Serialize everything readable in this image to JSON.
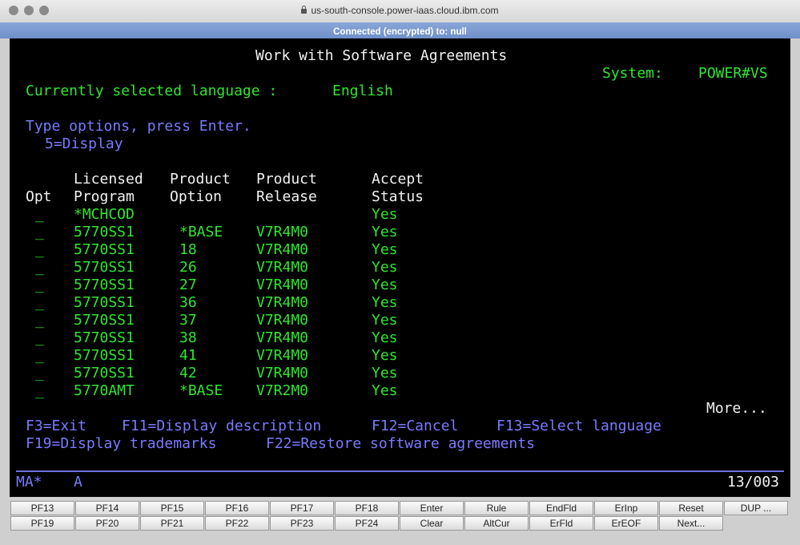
{
  "window": {
    "url": "us-south-console.power-iaas.cloud.ibm.com",
    "connection_status": "Connected (encrypted) to: null"
  },
  "screen": {
    "title": "Work with Software Agreements",
    "system_label": "System:",
    "system_name": "POWER#VS",
    "language_label": "Currently selected language :",
    "language_value": "English",
    "instruction": "Type options, press Enter.",
    "option_5": "5=Display",
    "headers": {
      "col1_line2": "Opt",
      "col2_line1": "Licensed",
      "col2_line2": "Program",
      "col3_line1": "Product",
      "col3_line2": "Option",
      "col4_line1": "Product",
      "col4_line2": "Release",
      "col5_line1": "Accept",
      "col5_line2": "Status"
    },
    "rows": [
      {
        "opt": "_",
        "program": "*MCHCOD",
        "option": "",
        "release": "",
        "status": "Yes"
      },
      {
        "opt": "_",
        "program": "5770SS1",
        "option": "*BASE",
        "release": "V7R4M0",
        "status": "Yes"
      },
      {
        "opt": "_",
        "program": "5770SS1",
        "option": "18",
        "release": "V7R4M0",
        "status": "Yes"
      },
      {
        "opt": "_",
        "program": "5770SS1",
        "option": "26",
        "release": "V7R4M0",
        "status": "Yes"
      },
      {
        "opt": "_",
        "program": "5770SS1",
        "option": "27",
        "release": "V7R4M0",
        "status": "Yes"
      },
      {
        "opt": "_",
        "program": "5770SS1",
        "option": "36",
        "release": "V7R4M0",
        "status": "Yes"
      },
      {
        "opt": "_",
        "program": "5770SS1",
        "option": "37",
        "release": "V7R4M0",
        "status": "Yes"
      },
      {
        "opt": "_",
        "program": "5770SS1",
        "option": "38",
        "release": "V7R4M0",
        "status": "Yes"
      },
      {
        "opt": "_",
        "program": "5770SS1",
        "option": "41",
        "release": "V7R4M0",
        "status": "Yes"
      },
      {
        "opt": "_",
        "program": "5770SS1",
        "option": "42",
        "release": "V7R4M0",
        "status": "Yes"
      },
      {
        "opt": "_",
        "program": "5770AMT",
        "option": "*BASE",
        "release": "V7R2M0",
        "status": "Yes"
      }
    ],
    "more": "More...",
    "fkeys_line1": [
      "F3=Exit",
      "F11=Display description",
      "F12=Cancel",
      "F13=Select language"
    ],
    "fkeys_line2": [
      "F19=Display trademarks",
      "F22=Restore software agreements"
    ],
    "status_left": "MA*",
    "status_mid": "A",
    "cursor_pos": "13/003"
  },
  "keypad": {
    "row1": [
      "PF13",
      "PF14",
      "PF15",
      "PF16",
      "PF17",
      "PF18",
      "Enter",
      "Rule",
      "EndFld",
      "ErInp",
      "Reset",
      "DUP ..."
    ],
    "row2": [
      "PF19",
      "PF20",
      "PF21",
      "PF22",
      "PF23",
      "PF24",
      "Clear",
      "AltCur",
      "ErFld",
      "ErEOF",
      "Next...",
      ""
    ]
  }
}
